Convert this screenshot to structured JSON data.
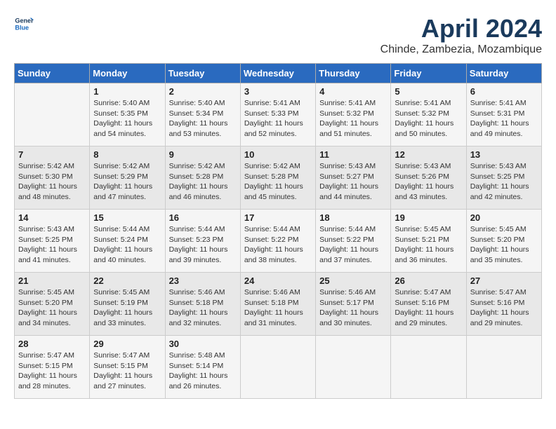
{
  "logo": {
    "line1": "General",
    "line2": "Blue"
  },
  "title": "April 2024",
  "location": "Chinde, Zambezia, Mozambique",
  "weekdays": [
    "Sunday",
    "Monday",
    "Tuesday",
    "Wednesday",
    "Thursday",
    "Friday",
    "Saturday"
  ],
  "weeks": [
    [
      {
        "day": "",
        "info": ""
      },
      {
        "day": "1",
        "info": "Sunrise: 5:40 AM\nSunset: 5:35 PM\nDaylight: 11 hours\nand 54 minutes."
      },
      {
        "day": "2",
        "info": "Sunrise: 5:40 AM\nSunset: 5:34 PM\nDaylight: 11 hours\nand 53 minutes."
      },
      {
        "day": "3",
        "info": "Sunrise: 5:41 AM\nSunset: 5:33 PM\nDaylight: 11 hours\nand 52 minutes."
      },
      {
        "day": "4",
        "info": "Sunrise: 5:41 AM\nSunset: 5:32 PM\nDaylight: 11 hours\nand 51 minutes."
      },
      {
        "day": "5",
        "info": "Sunrise: 5:41 AM\nSunset: 5:32 PM\nDaylight: 11 hours\nand 50 minutes."
      },
      {
        "day": "6",
        "info": "Sunrise: 5:41 AM\nSunset: 5:31 PM\nDaylight: 11 hours\nand 49 minutes."
      }
    ],
    [
      {
        "day": "7",
        "info": "Sunrise: 5:42 AM\nSunset: 5:30 PM\nDaylight: 11 hours\nand 48 minutes."
      },
      {
        "day": "8",
        "info": "Sunrise: 5:42 AM\nSunset: 5:29 PM\nDaylight: 11 hours\nand 47 minutes."
      },
      {
        "day": "9",
        "info": "Sunrise: 5:42 AM\nSunset: 5:28 PM\nDaylight: 11 hours\nand 46 minutes."
      },
      {
        "day": "10",
        "info": "Sunrise: 5:42 AM\nSunset: 5:28 PM\nDaylight: 11 hours\nand 45 minutes."
      },
      {
        "day": "11",
        "info": "Sunrise: 5:43 AM\nSunset: 5:27 PM\nDaylight: 11 hours\nand 44 minutes."
      },
      {
        "day": "12",
        "info": "Sunrise: 5:43 AM\nSunset: 5:26 PM\nDaylight: 11 hours\nand 43 minutes."
      },
      {
        "day": "13",
        "info": "Sunrise: 5:43 AM\nSunset: 5:25 PM\nDaylight: 11 hours\nand 42 minutes."
      }
    ],
    [
      {
        "day": "14",
        "info": "Sunrise: 5:43 AM\nSunset: 5:25 PM\nDaylight: 11 hours\nand 41 minutes."
      },
      {
        "day": "15",
        "info": "Sunrise: 5:44 AM\nSunset: 5:24 PM\nDaylight: 11 hours\nand 40 minutes."
      },
      {
        "day": "16",
        "info": "Sunrise: 5:44 AM\nSunset: 5:23 PM\nDaylight: 11 hours\nand 39 minutes."
      },
      {
        "day": "17",
        "info": "Sunrise: 5:44 AM\nSunset: 5:22 PM\nDaylight: 11 hours\nand 38 minutes."
      },
      {
        "day": "18",
        "info": "Sunrise: 5:44 AM\nSunset: 5:22 PM\nDaylight: 11 hours\nand 37 minutes."
      },
      {
        "day": "19",
        "info": "Sunrise: 5:45 AM\nSunset: 5:21 PM\nDaylight: 11 hours\nand 36 minutes."
      },
      {
        "day": "20",
        "info": "Sunrise: 5:45 AM\nSunset: 5:20 PM\nDaylight: 11 hours\nand 35 minutes."
      }
    ],
    [
      {
        "day": "21",
        "info": "Sunrise: 5:45 AM\nSunset: 5:20 PM\nDaylight: 11 hours\nand 34 minutes."
      },
      {
        "day": "22",
        "info": "Sunrise: 5:45 AM\nSunset: 5:19 PM\nDaylight: 11 hours\nand 33 minutes."
      },
      {
        "day": "23",
        "info": "Sunrise: 5:46 AM\nSunset: 5:18 PM\nDaylight: 11 hours\nand 32 minutes."
      },
      {
        "day": "24",
        "info": "Sunrise: 5:46 AM\nSunset: 5:18 PM\nDaylight: 11 hours\nand 31 minutes."
      },
      {
        "day": "25",
        "info": "Sunrise: 5:46 AM\nSunset: 5:17 PM\nDaylight: 11 hours\nand 30 minutes."
      },
      {
        "day": "26",
        "info": "Sunrise: 5:47 AM\nSunset: 5:16 PM\nDaylight: 11 hours\nand 29 minutes."
      },
      {
        "day": "27",
        "info": "Sunrise: 5:47 AM\nSunset: 5:16 PM\nDaylight: 11 hours\nand 29 minutes."
      }
    ],
    [
      {
        "day": "28",
        "info": "Sunrise: 5:47 AM\nSunset: 5:15 PM\nDaylight: 11 hours\nand 28 minutes."
      },
      {
        "day": "29",
        "info": "Sunrise: 5:47 AM\nSunset: 5:15 PM\nDaylight: 11 hours\nand 27 minutes."
      },
      {
        "day": "30",
        "info": "Sunrise: 5:48 AM\nSunset: 5:14 PM\nDaylight: 11 hours\nand 26 minutes."
      },
      {
        "day": "",
        "info": ""
      },
      {
        "day": "",
        "info": ""
      },
      {
        "day": "",
        "info": ""
      },
      {
        "day": "",
        "info": ""
      }
    ]
  ]
}
